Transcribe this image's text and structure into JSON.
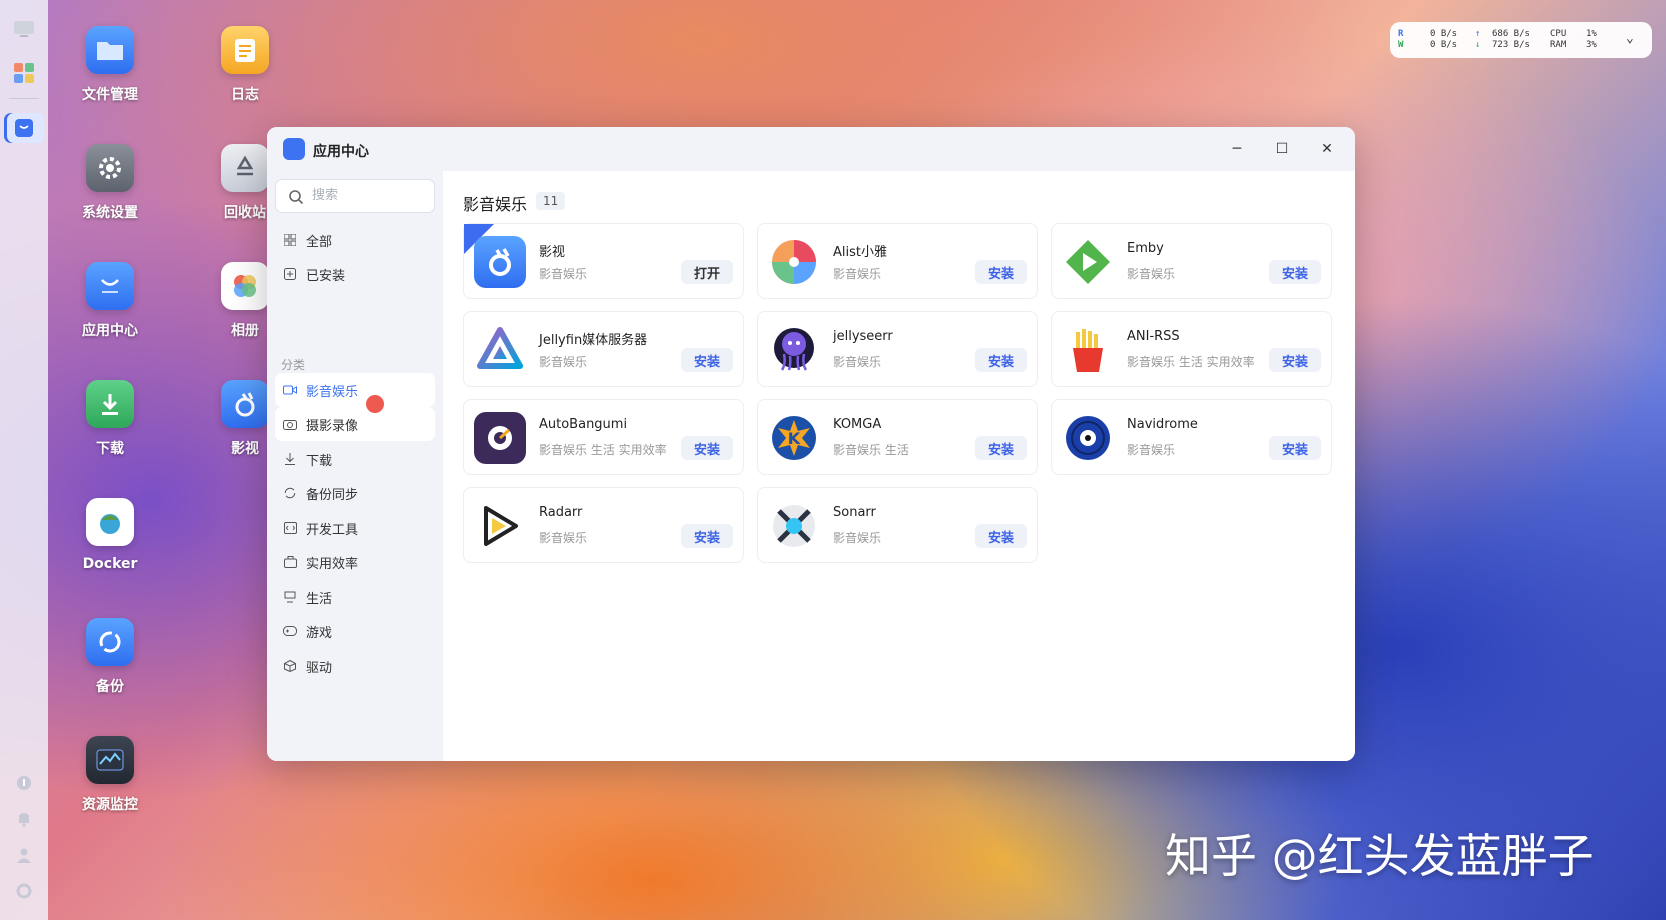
{
  "desktop": {
    "icons": [
      {
        "label": "文件管理"
      },
      {
        "label": "日志"
      },
      {
        "label": "系统设置"
      },
      {
        "label": "回收站"
      },
      {
        "label": "应用中心"
      },
      {
        "label": "相册"
      },
      {
        "label": "下载"
      },
      {
        "label": "影视"
      },
      {
        "label": "Docker"
      },
      {
        "label": "备份"
      },
      {
        "label": "资源监控"
      }
    ]
  },
  "status": {
    "r_label": "R",
    "w_label": "W",
    "r_rate": "0  B/s",
    "w_rate": "0  B/s",
    "up_rate": "686  B/s",
    "down_rate": "723  B/s",
    "cpu_label": "CPU",
    "ram_label": "RAM",
    "cpu_val": "1%",
    "ram_val": "3%"
  },
  "window": {
    "title": "应用中心",
    "search_placeholder": "搜索",
    "nav_top": [
      {
        "label": "全部",
        "icon": "grid-icon"
      },
      {
        "label": "已安装",
        "icon": "installed-icon"
      }
    ],
    "section_label": "分类",
    "categories": [
      {
        "label": "影音娱乐",
        "icon": "video-icon"
      },
      {
        "label": "摄影录像",
        "icon": "camera-icon"
      },
      {
        "label": "下载",
        "icon": "download-icon"
      },
      {
        "label": "备份同步",
        "icon": "sync-icon"
      },
      {
        "label": "开发工具",
        "icon": "code-icon"
      },
      {
        "label": "实用效率",
        "icon": "briefcase-icon"
      },
      {
        "label": "生活",
        "icon": "life-icon"
      },
      {
        "label": "游戏",
        "icon": "gamepad-icon"
      },
      {
        "label": "驱动",
        "icon": "cube-icon"
      }
    ],
    "main_title": "影音娱乐",
    "main_count": "11",
    "apps": [
      {
        "name": "影视",
        "category": "影音娱乐",
        "button": "打开"
      },
      {
        "name": "Alist小雅",
        "category": "影音娱乐",
        "button": "安装"
      },
      {
        "name": "Emby",
        "category": "影音娱乐",
        "button": "安装"
      },
      {
        "name": "Jellyfin媒体服务器",
        "category": "影音娱乐",
        "button": "安装"
      },
      {
        "name": "jellyseerr",
        "category": "影音娱乐",
        "button": "安装"
      },
      {
        "name": "ANI-RSS",
        "category": "影音娱乐 生活 实用效率",
        "button": "安装"
      },
      {
        "name": "AutoBangumi",
        "category": "影音娱乐 生活 实用效率",
        "button": "安装"
      },
      {
        "name": "KOMGA",
        "category": "影音娱乐 生活",
        "button": "安装"
      },
      {
        "name": "Navidrome",
        "category": "影音娱乐",
        "button": "安装"
      },
      {
        "name": "Radarr",
        "category": "影音娱乐",
        "button": "安装"
      },
      {
        "name": "Sonarr",
        "category": "影音娱乐",
        "button": "安装"
      }
    ]
  },
  "watermark": "知乎 @红头发蓝胖子"
}
